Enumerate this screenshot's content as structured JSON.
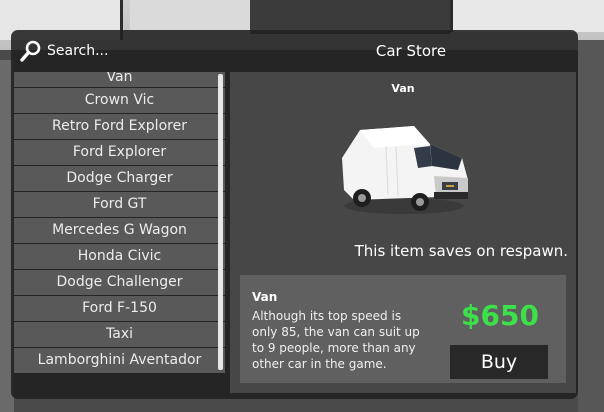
{
  "search": {
    "placeholder": "Search..."
  },
  "store": {
    "title": "Car Store"
  },
  "cars": [
    "Van",
    "Crown Vic",
    "Retro Ford Explorer",
    "Ford Explorer",
    "Dodge Charger",
    "Ford GT",
    "Mercedes G Wagon",
    "Honda Civic",
    "Dodge Challenger",
    "Ford F-150",
    "Taxi",
    "Lamborghini Aventador"
  ],
  "selected": {
    "name": "Van",
    "note": "This item saves on respawn.",
    "info_name": "Van",
    "description": "Although its top speed is only 85, the van can suit up to 9 people, more than any other car in the game.",
    "price": "$650",
    "buy_label": "Buy"
  },
  "colors": {
    "price": "#3ce14a",
    "panel": "#474747"
  }
}
